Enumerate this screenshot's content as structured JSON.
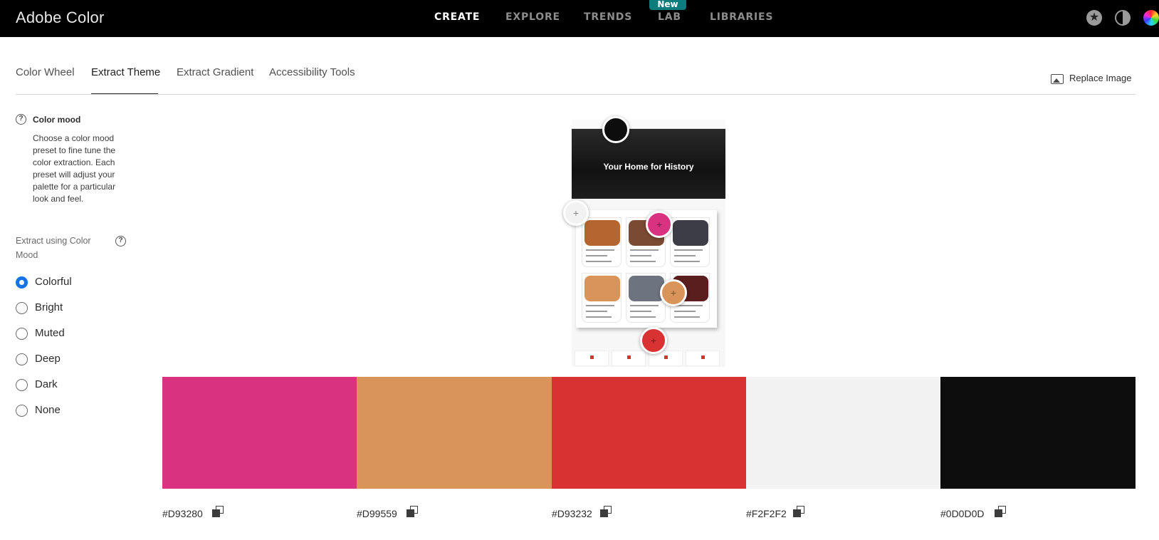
{
  "app": {
    "title": "Adobe Color"
  },
  "nav": {
    "items": [
      "CREATE",
      "EXPLORE",
      "TRENDS",
      "LAB",
      "LIBRARIES"
    ],
    "active": "CREATE",
    "badge": "New"
  },
  "header_icons": [
    "star-icon",
    "theme-toggle-icon",
    "color-wheel-icon"
  ],
  "tabs": {
    "items": [
      "Color Wheel",
      "Extract Theme",
      "Extract Gradient",
      "Accessibility Tools"
    ],
    "active": "Extract Theme"
  },
  "replace_image": {
    "label": "Replace Image"
  },
  "sidebar": {
    "color_mood_title": "Color mood",
    "color_mood_description": "Choose a color mood preset to fine tune the color extraction. Each preset will adjust your palette for a particular look and feel.",
    "extract_label": "Extract using Color Mood",
    "moods": [
      "Colorful",
      "Bright",
      "Muted",
      "Deep",
      "Dark",
      "None"
    ],
    "selected_mood": "Colorful"
  },
  "preview": {
    "hero_title": "Your Home for History",
    "marker_colors": [
      "#0D0D0D",
      "#F2F2F2",
      "#D93280",
      "#D99559",
      "#D93232"
    ]
  },
  "swatches": [
    {
      "hex": "#D93280",
      "color": "#D93280"
    },
    {
      "hex": "#D99559",
      "color": "#D99559"
    },
    {
      "hex": "#D93232",
      "color": "#D93232"
    },
    {
      "hex": "#F2F2F2",
      "color": "#F2F2F2"
    },
    {
      "hex": "#0D0D0D",
      "color": "#0D0D0D"
    }
  ],
  "colors": {
    "accent": "#1473E6",
    "badge": "#0D7C7C"
  }
}
